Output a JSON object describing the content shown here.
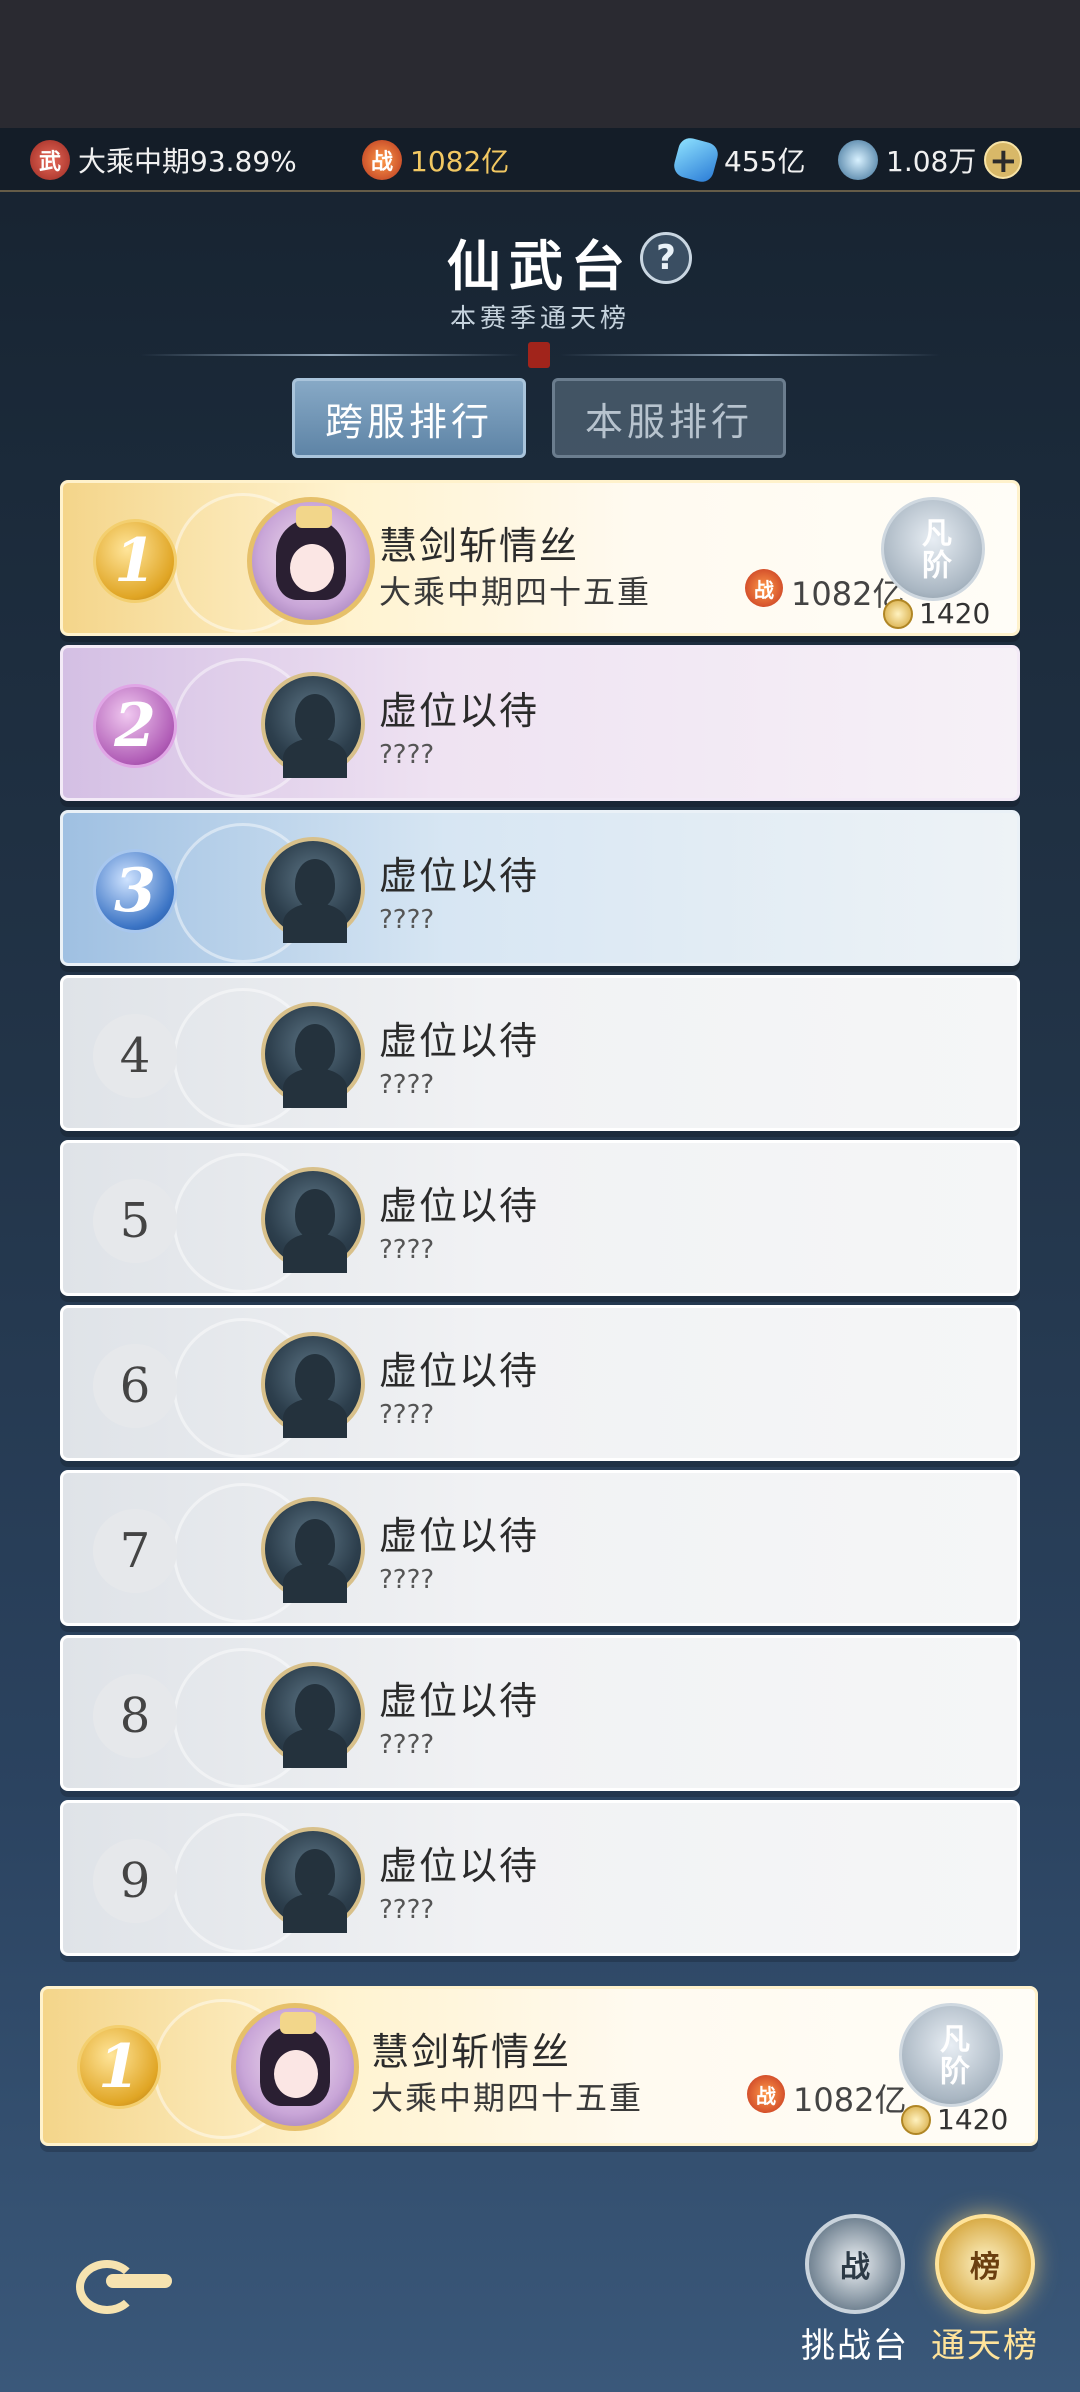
{
  "status_bar": {
    "realm_icon": "wu-icon",
    "realm_label": "武",
    "realm_text": "大乘中期93.89%",
    "power_icon_label": "战",
    "power_text": "1082亿",
    "gem_text": "455亿",
    "coin_text": "1.08万",
    "plus_label": "+"
  },
  "header": {
    "title": "仙武台",
    "help_label": "?",
    "subtitle": "本赛季通天榜"
  },
  "tabs": [
    {
      "label": "跨服排行",
      "active": true
    },
    {
      "label": "本服排行",
      "active": false
    }
  ],
  "ranking": [
    {
      "rank": "1",
      "name": "慧剑斩情丝",
      "realm": "大乘中期四十五重",
      "power_icon": "战",
      "power": "1082亿",
      "grade": "凡阶",
      "score": "1420"
    },
    {
      "rank": "2",
      "name": "虚位以待",
      "sub": "????"
    },
    {
      "rank": "3",
      "name": "虚位以待",
      "sub": "????"
    },
    {
      "rank": "4",
      "name": "虚位以待",
      "sub": "????"
    },
    {
      "rank": "5",
      "name": "虚位以待",
      "sub": "????"
    },
    {
      "rank": "6",
      "name": "虚位以待",
      "sub": "????"
    },
    {
      "rank": "7",
      "name": "虚位以待",
      "sub": "????"
    },
    {
      "rank": "8",
      "name": "虚位以待",
      "sub": "????"
    },
    {
      "rank": "9",
      "name": "虚位以待",
      "sub": "????"
    }
  ],
  "my_rank": {
    "rank": "1",
    "name": "慧剑斩情丝",
    "realm": "大乘中期四十五重",
    "power_icon": "战",
    "power": "1082亿",
    "grade": "凡阶",
    "score": "1420"
  },
  "bottom_nav": {
    "challenge_icon": "战",
    "challenge_label": "挑战台",
    "rank_icon": "榜",
    "rank_label": "通天榜"
  }
}
